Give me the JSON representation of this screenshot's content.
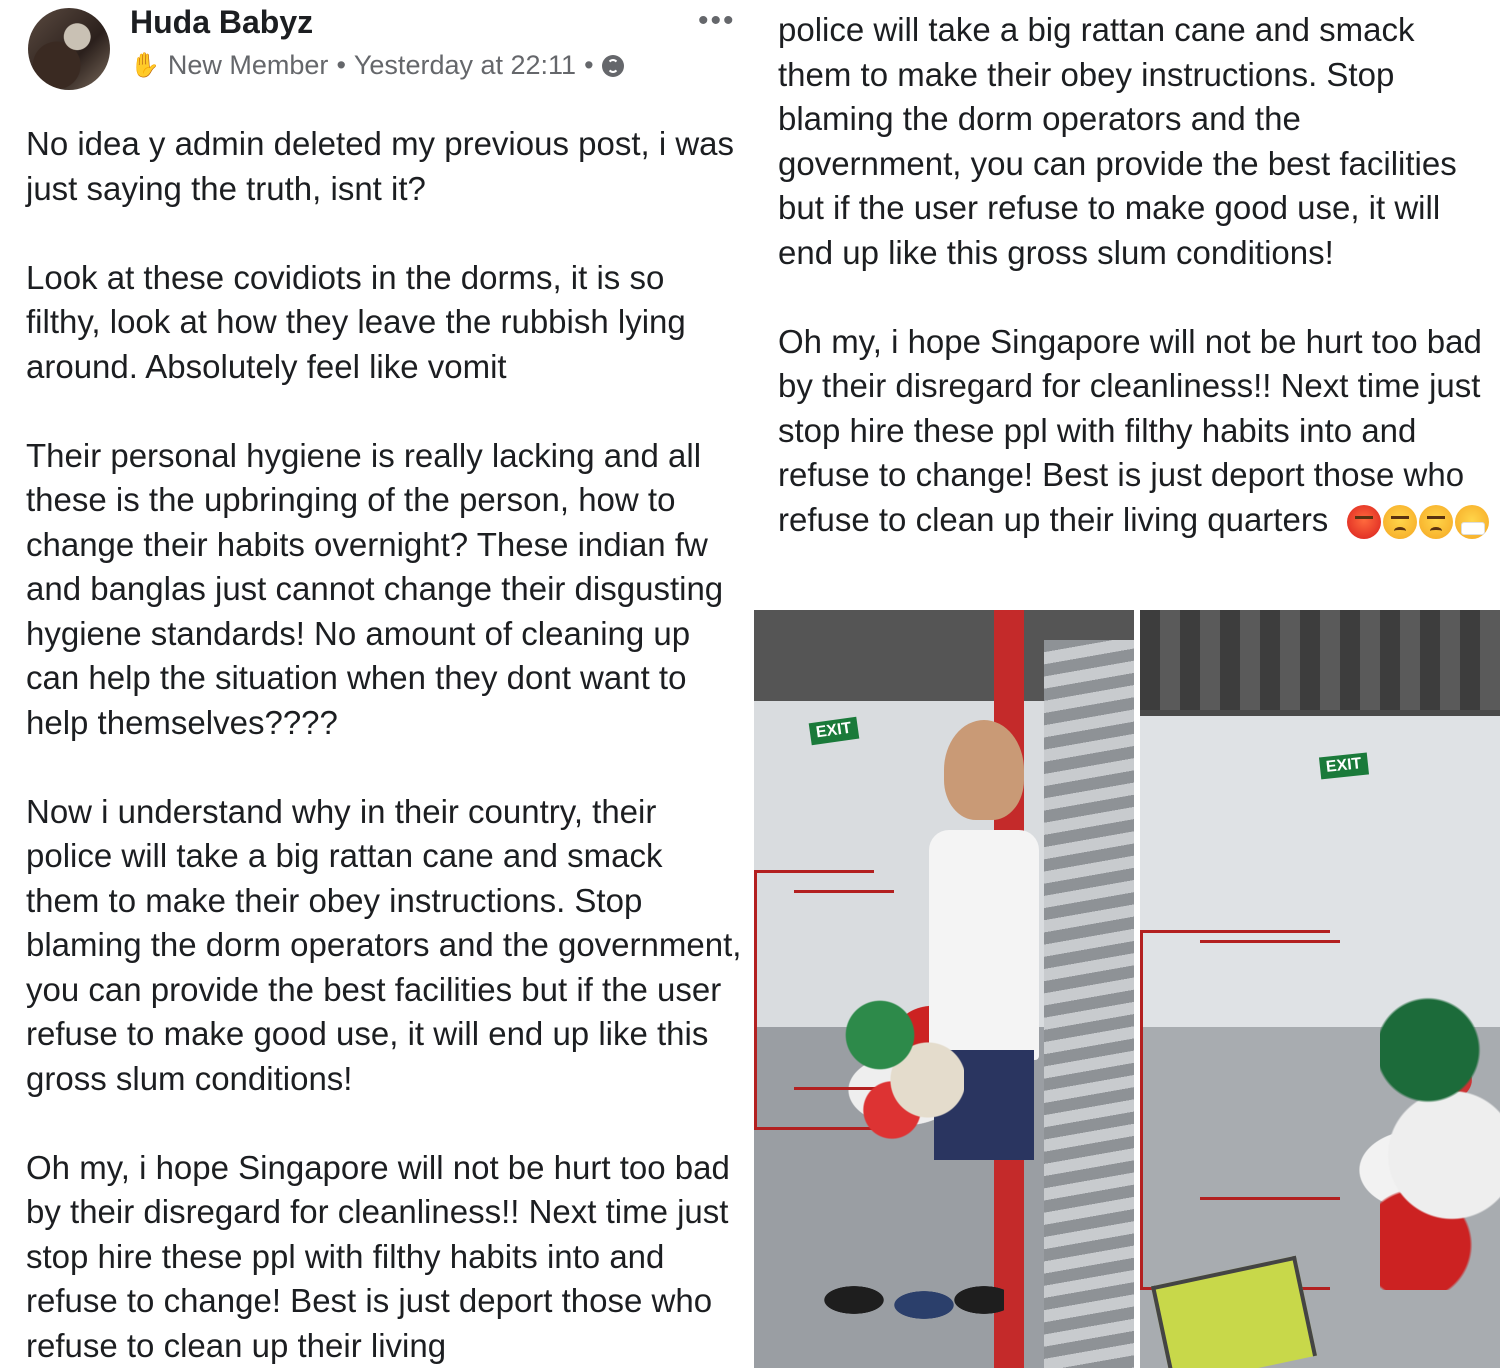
{
  "post": {
    "author": "Huda Babyz",
    "badge": "New Member",
    "timestamp": "Yesterday at 22:11",
    "separator": "•",
    "more": "•••",
    "icons": {
      "badge": "wave-hand-icon",
      "privacy": "globe-icon",
      "menu": "more-options-icon"
    }
  },
  "left_paragraphs": [
    "No idea y admin deleted my previous post, i was just saying the truth, isnt it?",
    "Look at these covidiots in the dorms, it is so filthy, look at how they leave the rubbish lying around. Absolutely feel like vomit",
    "Their personal hygiene is really lacking and all these is the upbringing of the person, how to change their habits overnight? These indian fw and banglas just cannot change their disgusting hygiene standards! No amount of cleaning up can help the situation when they dont want to help themselves????",
    "Now i understand why in their country, their police will take a big rattan cane and smack them to make their obey instructions. Stop blaming the dorm operators and the government, you can provide the best facilities but if the user refuse to make good use, it will end up like this gross slum conditions!",
    "Oh my, i hope Singapore will not be hurt too bad by their disregard for cleanliness!! Next time just stop hire these ppl with filthy habits into and refuse to change! Best is just deport those who refuse to clean up their living"
  ],
  "right_paragraphs": [
    "police will take a big rattan cane and smack them to make their obey instructions. Stop blaming the dorm operators and the government, you can provide the best facilities but if the user refuse to make good use, it will end up like this gross slum conditions!",
    "Oh my, i hope Singapore will not be hurt too bad by their disregard for cleanliness!! Next time just stop hire these ppl with filthy habits into and refuse to change! Best is just deport those who refuse to clean up their living"
  ],
  "right_last_word": "quarters",
  "emojis": [
    "cursing-face-icon",
    "angry-face-icon",
    "angry-face-icon",
    "mask-face-icon"
  ],
  "photos": {
    "photo1_exit": "EXIT",
    "photo2_exit": "EXIT"
  },
  "colors": {
    "text": "#1c1e21",
    "meta": "#65676b",
    "rail": "#b32020"
  }
}
